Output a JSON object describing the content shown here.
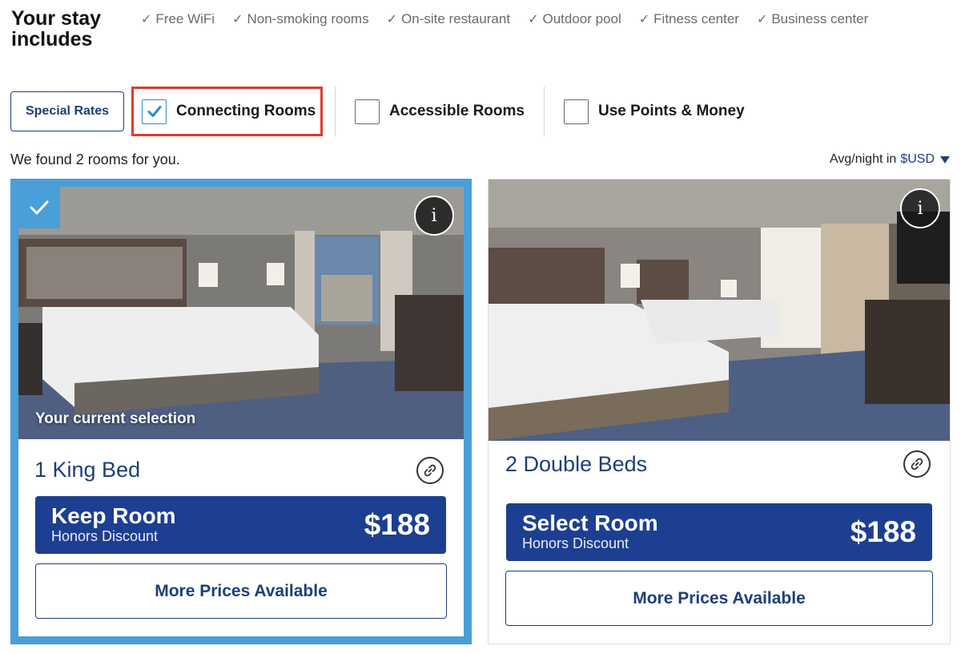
{
  "stay": {
    "title": "Your stay includes",
    "amenities": [
      "Free WiFi",
      "Non-smoking rooms",
      "On-site restaurant",
      "Outdoor pool",
      "Fitness center",
      "Business center"
    ]
  },
  "filters": {
    "special_rates_label": "Special Rates",
    "connecting_rooms": {
      "label": "Connecting Rooms",
      "checked": true
    },
    "accessible_rooms": {
      "label": "Accessible Rooms",
      "checked": false
    },
    "points_money": {
      "label": "Use Points & Money",
      "checked": false
    }
  },
  "results": {
    "found_text": "We found 2 rooms for you.",
    "avg_label": "Avg/night in",
    "currency": "$USD"
  },
  "rooms": [
    {
      "name": "1 King Bed",
      "selected": true,
      "selection_label": "Your current selection",
      "action_label": "Keep Room",
      "rate_label": "Honors Discount",
      "price": "$188",
      "more_label": "More Prices Available",
      "icons": [
        "info-icon",
        "link-icon",
        "checkmark-icon"
      ]
    },
    {
      "name": "2 Double Beds",
      "selected": false,
      "action_label": "Select Room",
      "rate_label": "Honors Discount",
      "price": "$188",
      "more_label": "More Prices Available",
      "icons": [
        "info-icon",
        "link-icon"
      ]
    }
  ],
  "colors": {
    "brand_navy": "#1d3f91",
    "text_navy": "#1d3f7a",
    "selected_blue": "#4a9fd8",
    "highlight_red": "#e23a2c"
  }
}
